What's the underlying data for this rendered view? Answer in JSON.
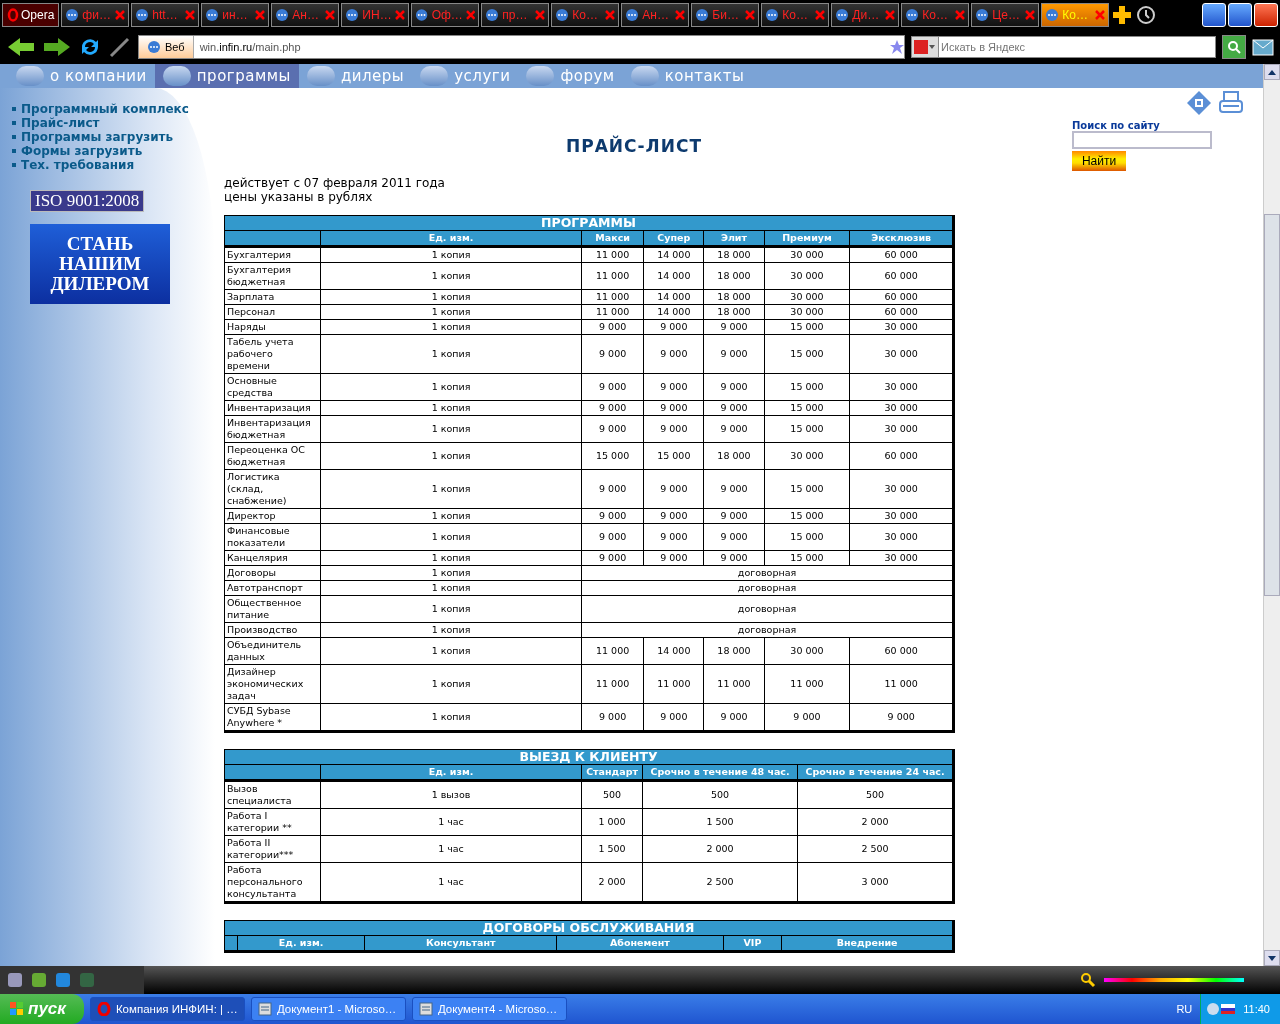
{
  "browser": {
    "menu_button": "Opera",
    "tabs": [
      {
        "label": "фи…",
        "selected": false
      },
      {
        "label": "htt…",
        "selected": false
      },
      {
        "label": "ин…",
        "selected": false
      },
      {
        "label": "Ан…",
        "selected": false
      },
      {
        "label": "ИН…",
        "selected": false
      },
      {
        "label": "Оф…",
        "selected": false
      },
      {
        "label": "пр…",
        "selected": false
      },
      {
        "label": "Ко…",
        "selected": false
      },
      {
        "label": "Ан…",
        "selected": false
      },
      {
        "label": "Би…",
        "selected": false
      },
      {
        "label": "Ко…",
        "selected": false
      },
      {
        "label": "Ди…",
        "selected": false
      },
      {
        "label": "Ко…",
        "selected": false
      },
      {
        "label": "Це…",
        "selected": false
      },
      {
        "label": "Ко…",
        "selected": true
      }
    ],
    "search_engine": "Веб",
    "url": "win.**infin.ru**/main.php",
    "search_placeholder": "Искать в Яндекс"
  },
  "site": {
    "nav": [
      {
        "label": "о компании",
        "selected": false
      },
      {
        "label": "программы",
        "selected": true
      },
      {
        "label": "дилеры",
        "selected": false
      },
      {
        "label": "услуги",
        "selected": false
      },
      {
        "label": "форум",
        "selected": false
      },
      {
        "label": "контакты",
        "selected": false
      }
    ],
    "sidebar_links": [
      "Программный комплекс",
      "Прайс-лист",
      "Программы загрузить",
      "Формы загрузить",
      "Тех. требования"
    ],
    "iso_badge": "ISO 9001:2008",
    "dealer_banner": [
      "СТАНЬ",
      "НАШИМ",
      "ДИЛЕРОМ"
    ],
    "search": {
      "label": "Поиск по сайту",
      "button": "Найти"
    },
    "title": "ПРАЙС-ЛИСТ",
    "notes": [
      "действует с 07 февраля 2011 года",
      "цены указаны в рублях"
    ],
    "tables": [
      {
        "title": "ПРОГРАММЫ",
        "columns": [
          "Ед. изм.",
          "Макси",
          "Супер",
          "Элит",
          "Премиум",
          "Эксклюзив"
        ],
        "rows": [
          {
            "name": "Бухгалтерия",
            "unit": "1 копия",
            "values": [
              "11 000",
              "14 000",
              "18 000",
              "30 000",
              "60 000"
            ]
          },
          {
            "name": "Бухгалтерия бюджетная",
            "unit": "1 копия",
            "values": [
              "11 000",
              "14 000",
              "18 000",
              "30 000",
              "60 000"
            ]
          },
          {
            "name": "Зарплата",
            "unit": "1 копия",
            "values": [
              "11 000",
              "14 000",
              "18 000",
              "30 000",
              "60 000"
            ]
          },
          {
            "name": "Персонал",
            "unit": "1 копия",
            "values": [
              "11 000",
              "14 000",
              "18 000",
              "30 000",
              "60 000"
            ]
          },
          {
            "name": "Наряды",
            "unit": "1 копия",
            "values": [
              "9 000",
              "9 000",
              "9 000",
              "15 000",
              "30 000"
            ]
          },
          {
            "name": "Табель учета рабочего времени",
            "unit": "1 копия",
            "values": [
              "9 000",
              "9 000",
              "9 000",
              "15 000",
              "30 000"
            ]
          },
          {
            "name": "Основные средства",
            "unit": "1 копия",
            "values": [
              "9 000",
              "9 000",
              "9 000",
              "15 000",
              "30 000"
            ]
          },
          {
            "name": "Инвентаризация",
            "unit": "1 копия",
            "values": [
              "9 000",
              "9 000",
              "9 000",
              "15 000",
              "30 000"
            ]
          },
          {
            "name": "Инвентаризация бюджетная",
            "unit": "1 копия",
            "values": [
              "9 000",
              "9 000",
              "9 000",
              "15 000",
              "30 000"
            ]
          },
          {
            "name": "Переоценка ОС бюджетная",
            "unit": "1 копия",
            "values": [
              "15 000",
              "15 000",
              "18 000",
              "30 000",
              "60 000"
            ]
          },
          {
            "name": "Логистика (склад, снабжение)",
            "unit": "1 копия",
            "values": [
              "9 000",
              "9 000",
              "9 000",
              "15 000",
              "30 000"
            ]
          },
          {
            "name": "Директор",
            "unit": "1 копия",
            "values": [
              "9 000",
              "9 000",
              "9 000",
              "15 000",
              "30 000"
            ]
          },
          {
            "name": "Финансовые показатели",
            "unit": "1 копия",
            "values": [
              "9 000",
              "9 000",
              "9 000",
              "15 000",
              "30 000"
            ]
          },
          {
            "name": "Канцелярия",
            "unit": "1 копия",
            "values": [
              "9 000",
              "9 000",
              "9 000",
              "15 000",
              "30 000"
            ]
          },
          {
            "name": "Договоры",
            "unit": "1 копия",
            "values": [
              "договорная"
            ]
          },
          {
            "name": "Автотранспорт",
            "unit": "1 копия",
            "values": [
              "договорная"
            ]
          },
          {
            "name": "Общественное питание",
            "unit": "1 копия",
            "values": [
              "договорная"
            ]
          },
          {
            "name": "Производство",
            "unit": "1 копия",
            "values": [
              "договорная"
            ]
          },
          {
            "name": "Объединитель данных",
            "unit": "1 копия",
            "values": [
              "11 000",
              "14 000",
              "18 000",
              "30 000",
              "60 000"
            ]
          },
          {
            "name": "Дизайнер экономических задач",
            "unit": "1 копия",
            "values": [
              "11 000",
              "11 000",
              "11 000",
              "11 000",
              "11 000"
            ]
          },
          {
            "name": "СУБД Sybase Anywhere *",
            "unit": "1 копия",
            "values": [
              "9 000",
              "9 000",
              "9 000",
              "9 000",
              "9 000"
            ]
          }
        ]
      },
      {
        "title": "ВЫЕЗД К КЛИЕНТУ",
        "columns": [
          "Ед. изм.",
          "Стандарт",
          "Срочно в течение 48 час.",
          "Срочно в течение 24 час."
        ],
        "rows": [
          {
            "name": "Вызов специалиста",
            "unit": "1 вызов",
            "values": [
              "500",
              "500",
              "500"
            ]
          },
          {
            "name": "Работа I категории **",
            "unit": "1 час",
            "values": [
              "1 000",
              "1 500",
              "2 000"
            ]
          },
          {
            "name": "Работа II категории***",
            "unit": "1 час",
            "values": [
              "1 500",
              "2 000",
              "2 500"
            ]
          },
          {
            "name": "Работа персонального консультанта",
            "unit": "1 час",
            "values": [
              "2 000",
              "2 500",
              "3 000"
            ]
          }
        ]
      },
      {
        "title": "ДОГОВОРЫ ОБСЛУЖИВАНИЯ",
        "columns": [
          "Ед. изм.",
          "Консультант",
          "Абонемент",
          "VIP",
          "Внедрение"
        ]
      }
    ]
  },
  "taskbar": {
    "start": "пуск",
    "tasks": [
      {
        "label": "Компания ИНФИН: | …",
        "selected": true
      },
      {
        "label": "Документ1 - Microso…",
        "selected": false
      },
      {
        "label": "Документ4 - Microso…",
        "selected": false
      }
    ],
    "language": "RU",
    "clock": "11:40"
  }
}
